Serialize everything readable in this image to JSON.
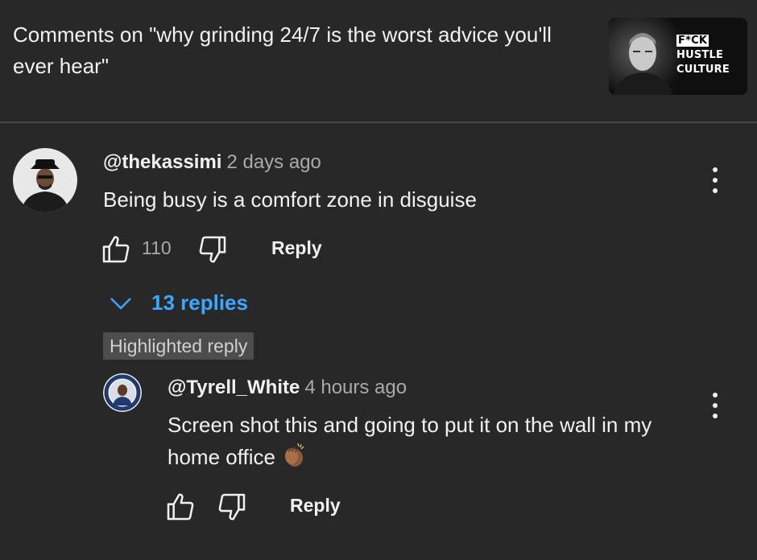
{
  "header": {
    "title": "Comments on \"why grinding 24/7 is the worst advice you'll ever hear\"",
    "thumbnail": {
      "line1": "F*CK",
      "line2": "HUSTLE",
      "line3": "CULTURE"
    }
  },
  "comment": {
    "author": "@thekassimi",
    "time": "2 days ago",
    "text": "Being busy is a comfort zone in disguise",
    "likes": "110",
    "reply_label": "Reply",
    "replies_label": "13 replies"
  },
  "highlighted_label": "Highlighted reply",
  "reply": {
    "author": "@Tyrell_White",
    "time": "4 hours ago",
    "text": "Screen shot this and going to put it on the wall in my home office",
    "emoji": "clapping-hands-medium-dark-skin",
    "reply_label": "Reply"
  },
  "colors": {
    "background": "#282828",
    "link": "#3ea6ff",
    "secondary_text": "#aaaaaa",
    "badge_bg": "#4d4d4d"
  }
}
